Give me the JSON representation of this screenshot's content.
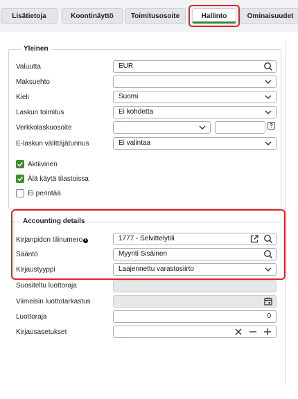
{
  "tabs": [
    {
      "label": "Lisätietoja",
      "active": false
    },
    {
      "label": "Koontinäyttö",
      "active": false
    },
    {
      "label": "Toimitusosoite",
      "active": false
    },
    {
      "label": "Hallinto",
      "active": true
    },
    {
      "label": "Ominaisuudet",
      "active": false
    }
  ],
  "general": {
    "title": "Yleinen",
    "currency": {
      "label": "Valuutta",
      "value": "EUR"
    },
    "payment_terms": {
      "label": "Maksuehto",
      "value": ""
    },
    "language": {
      "label": "Kieli",
      "value": "Suomi"
    },
    "invoice_delivery": {
      "label": "Laskun toimitus",
      "value": "Ei kohdetta"
    },
    "einvoice_address": {
      "label": "Verkkolaskuosoite",
      "value": "",
      "value2": "",
      "help": "?"
    },
    "einvoice_operator": {
      "label": "E-laskun välittäjätunnus",
      "value": "Ei valintaa"
    },
    "checkboxes": [
      {
        "label": "Aktiivinen",
        "checked": true
      },
      {
        "label": "Älä käytä tilastoissa",
        "checked": true
      },
      {
        "label": "Ei perintää",
        "checked": false
      }
    ]
  },
  "accounting": {
    "title": "Accounting details",
    "account_number": {
      "label": "Kirjanpidon tilinumero",
      "value": "1777 - Selvittelytili"
    },
    "rule": {
      "label": "Sääntö",
      "value": "Myynti Sisäinen"
    },
    "posting_type": {
      "label": "Kirjaustyyppi",
      "value": "Laajennettu varastosiirto"
    }
  },
  "credit": {
    "suggested_limit": {
      "label": "Suositeltu luottoraja",
      "value": ""
    },
    "last_check": {
      "label": "Viimeisin luottotarkastus",
      "value": ""
    },
    "limit": {
      "label": "Luottoraja",
      "value": "0"
    },
    "posting_settings": {
      "label": "Kirjausasetukset",
      "value": ""
    }
  },
  "colors": {
    "highlight": "#e02020",
    "active_tab": "#2e8b3a",
    "checkbox": "#3f8f2f"
  },
  "icons": [
    "search-icon",
    "chevron-down-icon",
    "external-link-icon",
    "calendar-icon",
    "close-icon",
    "minus-icon",
    "plus-icon",
    "info-icon",
    "help-icon",
    "check-icon"
  ]
}
